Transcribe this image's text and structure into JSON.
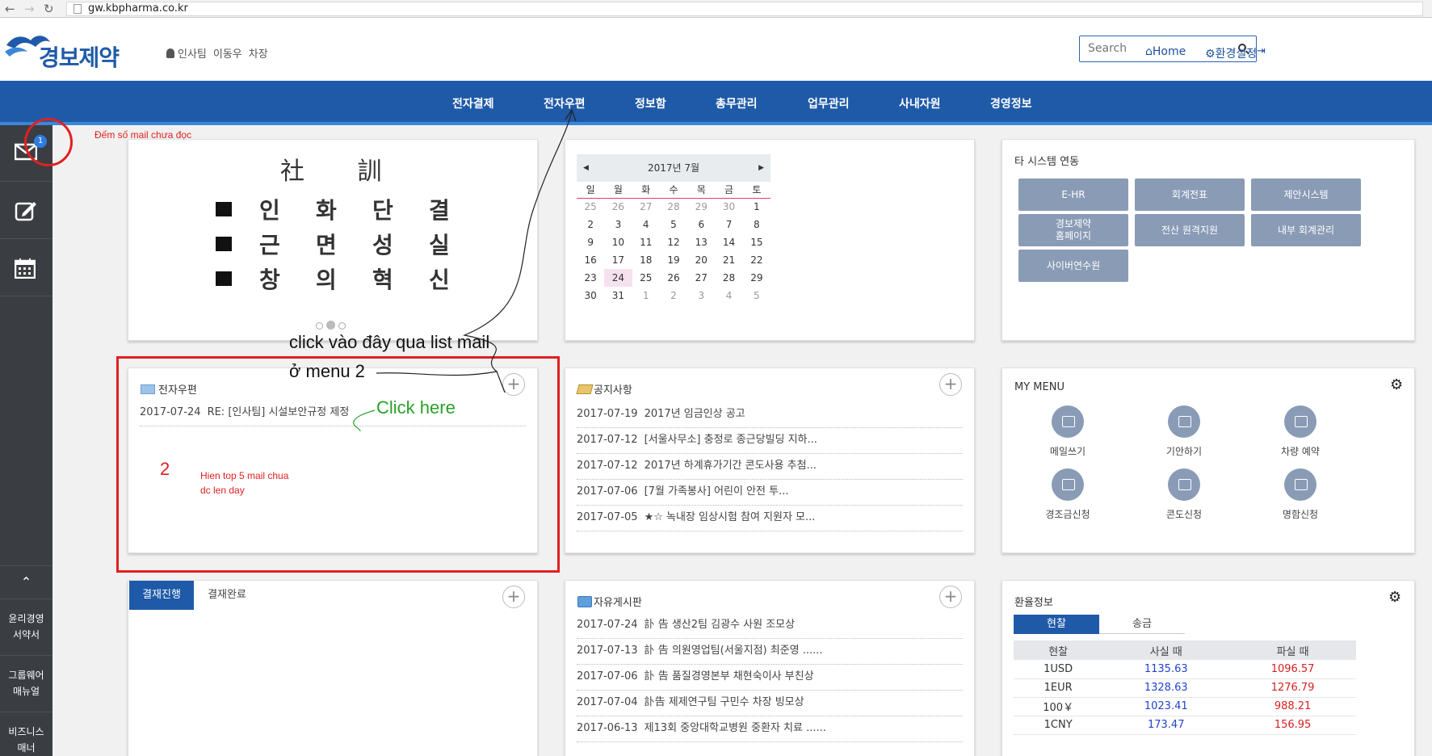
{
  "browser": {
    "url": "gw.kbpharma.co.kr"
  },
  "header": {
    "logo_text": "경보제약",
    "user": {
      "team": "인사팀",
      "name": "이동우",
      "title": "차장"
    },
    "search_placeholder": "Search",
    "home_label": "Home",
    "settings_label": "환경설정"
  },
  "nav": [
    "전자결제",
    "전자우편",
    "정보함",
    "총무관리",
    "업무관리",
    "사내자원",
    "경영정보"
  ],
  "sidebar": {
    "mail_badge": "1",
    "bottom": [
      {
        "l1": "윤리경영",
        "l2": "서약서"
      },
      {
        "l1": "그룹웨어",
        "l2": "매뉴얼"
      },
      {
        "l1": "비즈니스",
        "l2": "매너"
      }
    ]
  },
  "motto": {
    "title": "社 訓",
    "rows": [
      [
        "인",
        "화",
        "단",
        "결"
      ],
      [
        "근",
        "면",
        "성",
        "실"
      ],
      [
        "창",
        "의",
        "혁",
        "신"
      ]
    ]
  },
  "calendar": {
    "month": "2017년 7월",
    "weekdays": [
      "일",
      "월",
      "화",
      "수",
      "목",
      "금",
      "토"
    ],
    "weeks": [
      [
        "25",
        "26",
        "27",
        "28",
        "29",
        "30",
        "1"
      ],
      [
        "2",
        "3",
        "4",
        "5",
        "6",
        "7",
        "8"
      ],
      [
        "9",
        "10",
        "11",
        "12",
        "13",
        "14",
        "15"
      ],
      [
        "16",
        "17",
        "18",
        "19",
        "20",
        "21",
        "22"
      ],
      [
        "23",
        "24",
        "25",
        "26",
        "27",
        "28",
        "29"
      ],
      [
        "30",
        "31",
        "1",
        "2",
        "3",
        "4",
        "5"
      ]
    ],
    "today": "24"
  },
  "systems": {
    "title": "타 시스템 연동",
    "buttons": [
      "E-HR",
      "회계전표",
      "제안시스템",
      "경보제약\n홈페이지",
      "전산 원격지원",
      "내부 회계관리",
      "사이버연수원"
    ]
  },
  "mail_panel": {
    "title": "전자우편",
    "items": [
      {
        "date": "2017-07-24",
        "subject": "RE: [인사팀] 시설보안규정 제정"
      }
    ]
  },
  "notice_panel": {
    "title": "공지사항",
    "items": [
      {
        "date": "2017-07-19",
        "subject": "2017년 임금인상 공고"
      },
      {
        "date": "2017-07-12",
        "subject": "[서울사무소] 충정로 종근당빌딩 지하..."
      },
      {
        "date": "2017-07-12",
        "subject": "2017년 하계휴가기간 콘도사용 추첨..."
      },
      {
        "date": "2017-07-06",
        "subject": "[7월 가족봉사] 어린이 안전 투..."
      },
      {
        "date": "2017-07-05",
        "subject": "★☆ 녹내장 임상시험 참여 지원자 모..."
      }
    ]
  },
  "mymenu": {
    "title": "MY MENU",
    "items": [
      "메일쓰기",
      "기안하기",
      "차량 예약",
      "경조금신청",
      "콘도신청",
      "명함신청"
    ]
  },
  "approval_panel": {
    "tabs": [
      "결재진행",
      "결재완료"
    ]
  },
  "board_panel": {
    "title": "자유게시판",
    "items": [
      {
        "date": "2017-07-24",
        "subject": "訃 告 생산2팀 김광수 사원 조모상"
      },
      {
        "date": "2017-07-13",
        "subject": "訃 告 의원영업팀(서울지점) 최준영 ......"
      },
      {
        "date": "2017-07-06",
        "subject": "訃 告 품질경영본부 채현숙이사 부친상"
      },
      {
        "date": "2017-07-04",
        "subject": "訃告 제제연구팀 구민수 차장 빙모상"
      },
      {
        "date": "2017-06-13",
        "subject": "제13회 중앙대학교병원 중환자 치료 ......"
      }
    ]
  },
  "exchange": {
    "title": "환율정보",
    "tabs": [
      "현찰",
      "송금"
    ],
    "headers": [
      "현찰",
      "사실 때",
      "파실 때"
    ],
    "rows": [
      [
        "1USD",
        "1135.63",
        "1096.57"
      ],
      [
        "1EUR",
        "1328.63",
        "1276.79"
      ],
      [
        "100￥",
        "1023.41",
        "988.21"
      ],
      [
        "1CNY",
        "173.47",
        "156.95"
      ]
    ]
  },
  "annotations": {
    "count_note": "Đếm số mail chưa đọc",
    "click_note_1": "click vào đây qua list mail",
    "click_note_2": "ở menu 2",
    "click_here": "Click here",
    "num": "2",
    "top5_1": "Hien top 5 mail chua",
    "top5_2": "dc len day"
  },
  "colors": {
    "nav": "#1f5aa8",
    "sidebar": "#3a3d42",
    "sysbtn": "#8a9bb6",
    "annotation_red": "#e02020",
    "annotation_green": "#2aa12a"
  }
}
